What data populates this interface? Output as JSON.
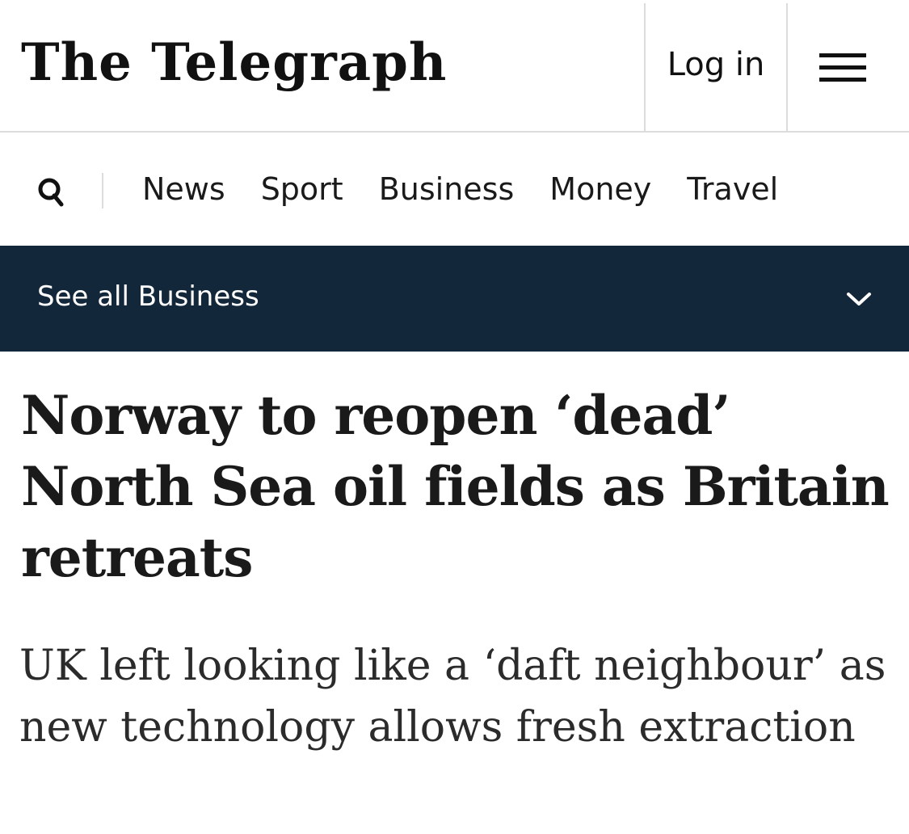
{
  "masthead": {
    "logo_text": "The Telegraph",
    "login_label": "Log in",
    "menu_icon": "hamburger-menu-icon"
  },
  "nav": {
    "search_icon": "search-icon",
    "items": [
      {
        "label": "News"
      },
      {
        "label": "Sport"
      },
      {
        "label": "Business"
      },
      {
        "label": "Money"
      },
      {
        "label": "Travel"
      }
    ]
  },
  "section_bar": {
    "label": "See all Business",
    "icon": "chevron-down-icon",
    "background": "#13273a"
  },
  "article": {
    "headline": "Norway to reopen ‘dead’ North Sea oil fields as Britain retreats",
    "standfirst": "UK left looking like a ‘daft neighbour’ as new technology allows fresh extraction"
  }
}
